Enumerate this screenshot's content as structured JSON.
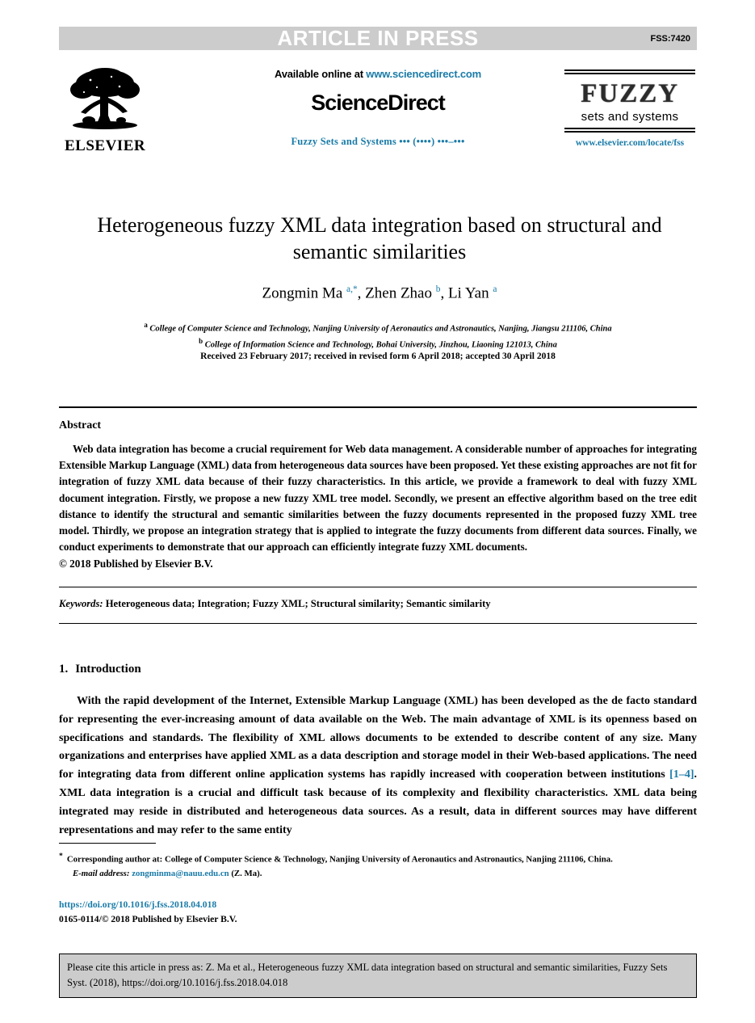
{
  "banner": {
    "label": "ARTICLE IN PRESS",
    "code": "FSS:7420",
    "bg_color": "#cccccc",
    "text_color": "#ffffff"
  },
  "masthead": {
    "publisher_name": "ELSEVIER",
    "available_online_prefix": "Available online at ",
    "available_online_url": "www.sciencedirect.com",
    "platform": "ScienceDirect",
    "journal_citation_line": "Fuzzy Sets and Systems ••• (••••) •••–•••",
    "journal_logo_top": "FUZZY",
    "journal_logo_bottom": "sets and systems",
    "journal_url": "www.elsevier.com/locate/fss",
    "link_color": "#1a7ba8"
  },
  "article": {
    "title": "Heterogeneous fuzzy XML data integration based on structural and semantic similarities",
    "authors_html": "Zongmin Ma <sup>a,</sup><sup>*</sup>, Zhen Zhao <sup>b</sup>, Li Yan <sup>a</sup>",
    "affiliation_a": "College of Computer Science and Technology, Nanjing University of Aeronautics and Astronautics, Nanjing, Jiangsu 211106, China",
    "affiliation_b": "College of Information Science and Technology, Bohai University, Jinzhou, Liaoning 121013, China",
    "history": "Received 23 February 2017; received in revised form 6 April 2018; accepted 30 April 2018"
  },
  "abstract": {
    "heading": "Abstract",
    "text": "Web data integration has become a crucial requirement for Web data management. A considerable number of approaches for integrating Extensible Markup Language (XML) data from heterogeneous data sources have been proposed. Yet these existing approaches are not fit for integration of fuzzy XML data because of their fuzzy characteristics. In this article, we provide a framework to deal with fuzzy XML document integration. Firstly, we propose a new fuzzy XML tree model. Secondly, we present an effective algorithm based on the tree edit distance to identify the structural and semantic similarities between the fuzzy documents represented in the proposed fuzzy XML tree model. Thirdly, we propose an integration strategy that is applied to integrate the fuzzy documents from different data sources. Finally, we conduct experiments to demonstrate that our approach can efficiently integrate fuzzy XML documents.",
    "copyright": "© 2018 Published by Elsevier B.V.",
    "keywords_label": "Keywords:",
    "keywords": "Heterogeneous data; Integration; Fuzzy XML; Structural similarity; Semantic similarity"
  },
  "introduction": {
    "number": "1.",
    "heading": "Introduction",
    "paragraph_part1": "With the rapid development of the Internet, Extensible Markup Language (XML) has been developed as the de facto standard for representing the ever-increasing amount of data available on the Web. The main advantage of XML is its openness based on specifications and standards. The flexibility of XML allows documents to be extended to describe content of any size. Many organizations and enterprises have applied XML as a data description and storage model in their Web-based applications. The need for integrating data from different online application systems has rapidly increased with cooperation between institutions ",
    "citation": "[1–4]",
    "paragraph_part2": ". XML data integration is a crucial and difficult task because of its complexity and flexibility characteristics. XML data being integrated may reside in distributed and heterogeneous data sources. As a result, data in different sources may have different representations and may refer to the same entity"
  },
  "footnotes": {
    "corresponding_marker": "*",
    "corresponding_text": "Corresponding author at: College of Computer Science & Technology, Nanjing University of Aeronautics and Astronautics, Nanjing 211106, China.",
    "email_label": "E-mail address:",
    "email": "zongminma@nauu.edu.cn",
    "email_owner": "(Z. Ma).",
    "doi": "https://doi.org/10.1016/j.fss.2018.04.018",
    "issn_line": "0165-0114/© 2018 Published by Elsevier B.V."
  },
  "cite_box": {
    "text": "Please cite this article in press as: Z. Ma et al., Heterogeneous fuzzy XML data integration based on structural and semantic similarities, Fuzzy Sets Syst. (2018), https://doi.org/10.1016/j.fss.2018.04.018"
  }
}
